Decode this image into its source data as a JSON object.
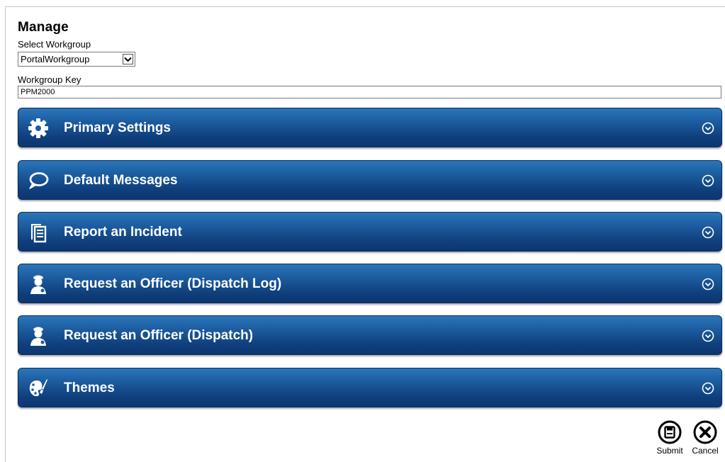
{
  "manage": {
    "title": "Manage",
    "workgroup_label": "Select Workgroup",
    "workgroup_value": "PortalWorkgroup",
    "key_label": "Workgroup Key",
    "key_value": "PPM2000"
  },
  "panels": [
    {
      "label": "Primary Settings",
      "icon": "gear-icon"
    },
    {
      "label": "Default Messages",
      "icon": "speech-bubble-icon"
    },
    {
      "label": "Report an Incident",
      "icon": "documents-icon"
    },
    {
      "label": "Request an Officer (Dispatch Log)",
      "icon": "officer-icon"
    },
    {
      "label": "Request an Officer (Dispatch)",
      "icon": "officer-icon"
    },
    {
      "label": "Themes",
      "icon": "palette-icon"
    }
  ],
  "actions": {
    "submit_label": "Submit",
    "cancel_label": "Cancel"
  },
  "colors": {
    "panel_top": "#2a76bb",
    "panel_bottom": "#0c3670",
    "panel_text": "#ffffff"
  }
}
